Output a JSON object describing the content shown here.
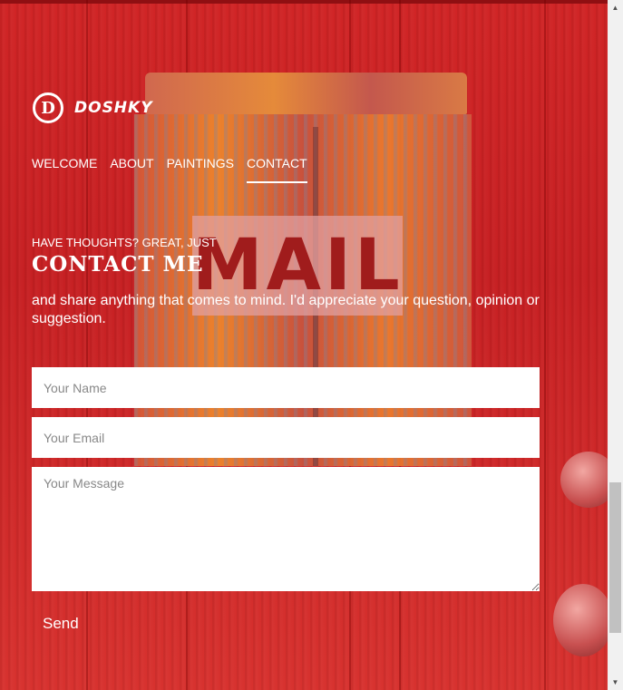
{
  "logo": {
    "mark": "D",
    "text": "DOSHKY"
  },
  "nav": {
    "items": [
      {
        "label": "WELCOME",
        "active": false
      },
      {
        "label": "ABOUT",
        "active": false
      },
      {
        "label": "PAINTINGS",
        "active": false
      },
      {
        "label": "CONTACT",
        "active": true
      }
    ]
  },
  "contact": {
    "eyebrow": "HAVE THOUGHTS? GREAT, JUST",
    "heading": "CONTACT ME",
    "intro": "and share anything that comes to mind. I'd appreciate your question, opinion or suggestion.",
    "name_placeholder": "Your Name",
    "email_placeholder": "Your Email",
    "message_placeholder": "Your Message",
    "send_label": "Send"
  },
  "background": {
    "sign_text": "MAIL"
  },
  "scrollbar": {
    "up_icon": "▲",
    "down_icon": "▼"
  },
  "colors": {
    "background": "#c81f20",
    "text": "#ffffff"
  }
}
